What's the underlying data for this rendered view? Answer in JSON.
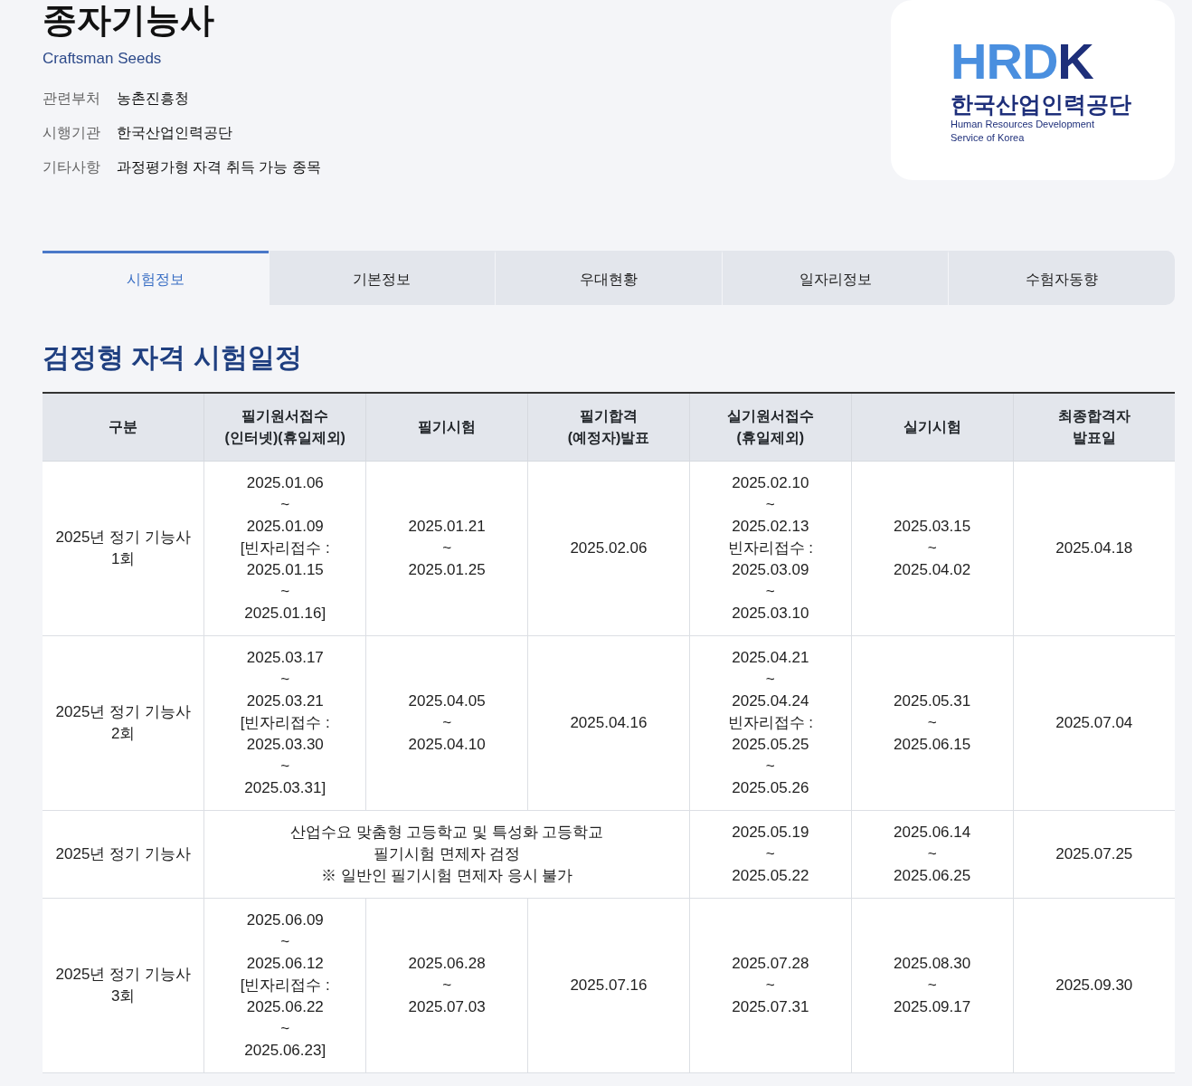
{
  "header": {
    "title": "종자기능사",
    "subtitle": "Craftsman Seeds",
    "info": [
      {
        "label": "관련부처",
        "value": "농촌진흥청"
      },
      {
        "label": "시행기관",
        "value": "한국산업인력공단"
      },
      {
        "label": "기타사항",
        "value": "과정평가형 자격 취득 가능 종목"
      }
    ]
  },
  "logo": {
    "mark": "HRDK",
    "name": "한국산업인력공단",
    "english": [
      "Human Resources Development",
      "Service of Korea"
    ]
  },
  "tabs": [
    {
      "label": "시험정보",
      "selected": true
    },
    {
      "label": "기본정보",
      "selected": false
    },
    {
      "label": "우대현황",
      "selected": false
    },
    {
      "label": "일자리정보",
      "selected": false
    },
    {
      "label": "수험자동향",
      "selected": false
    }
  ],
  "section_title": "검정형 자격 시험일정",
  "table": {
    "columns": [
      "구분",
      "필기원서접수\n(인터넷)(휴일제외)",
      "필기시험",
      "필기합격\n(예정자)발표",
      "실기원서접수\n(휴일제외)",
      "실기시험",
      "최종합격자\n발표일"
    ],
    "rows": [
      [
        {
          "text": "2025년 정기 기능사\n1회"
        },
        {
          "text": "2025.01.06\n~\n2025.01.09\n[빈자리접수 :\n2025.01.15\n~\n2025.01.16]"
        },
        {
          "text": "2025.01.21\n~\n2025.01.25"
        },
        {
          "text": "2025.02.06"
        },
        {
          "text": "2025.02.10\n~\n2025.02.13\n빈자리접수 :\n2025.03.09\n~\n2025.03.10"
        },
        {
          "text": "2025.03.15\n~\n2025.04.02"
        },
        {
          "text": "2025.04.18"
        }
      ],
      [
        {
          "text": "2025년 정기 기능사\n2회"
        },
        {
          "text": "2025.03.17\n~\n2025.03.21\n[빈자리접수 :\n2025.03.30\n~\n2025.03.31]"
        },
        {
          "text": "2025.04.05\n~\n2025.04.10"
        },
        {
          "text": "2025.04.16"
        },
        {
          "text": "2025.04.21\n~\n2025.04.24\n빈자리접수 :\n2025.05.25\n~\n2025.05.26"
        },
        {
          "text": "2025.05.31\n~\n2025.06.15"
        },
        {
          "text": "2025.07.04"
        }
      ],
      [
        {
          "text": "2025년 정기 기능사"
        },
        {
          "text": "산업수요 맞춤형 고등학교 및 특성화 고등학교\n필기시험 면제자 검정\n※ 일반인 필기시험 면제자 응시 불가",
          "colspan": 3
        },
        {
          "text": "2025.05.19\n~\n2025.05.22"
        },
        {
          "text": "2025.06.14\n~\n2025.06.25"
        },
        {
          "text": "2025.07.25"
        }
      ],
      [
        {
          "text": "2025년 정기 기능사\n3회"
        },
        {
          "text": "2025.06.09\n~\n2025.06.12\n[빈자리접수 :\n2025.06.22\n~\n2025.06.23]"
        },
        {
          "text": "2025.06.28\n~\n2025.07.03"
        },
        {
          "text": "2025.07.16"
        },
        {
          "text": "2025.07.28\n~\n2025.07.31"
        },
        {
          "text": "2025.08.30\n~\n2025.09.17"
        },
        {
          "text": "2025.09.30"
        }
      ]
    ]
  }
}
